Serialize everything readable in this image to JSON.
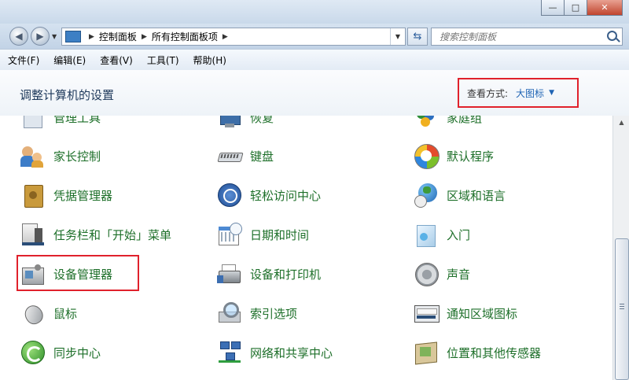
{
  "window": {
    "buttons": {
      "minimize": "—",
      "maximize": "□",
      "close": "✕"
    }
  },
  "address": {
    "breadcrumb": [
      "控制面板",
      "所有控制面板项"
    ],
    "search_placeholder": "搜索控制面板"
  },
  "menu": [
    "文件(F)",
    "编辑(E)",
    "查看(V)",
    "工具(T)",
    "帮助(H)"
  ],
  "header": {
    "title": "调整计算机的设置",
    "view_by_label": "查看方式:",
    "view_by_value": "大图标"
  },
  "items": {
    "row0": [
      "管理工具",
      "恢复",
      "家庭组"
    ],
    "row1": [
      "家长控制",
      "键盘",
      "默认程序"
    ],
    "row2": [
      "凭据管理器",
      "轻松访问中心",
      "区域和语言"
    ],
    "row3": [
      "任务栏和「开始」菜单",
      "日期和时间",
      "入门"
    ],
    "row4": [
      "设备管理器",
      "设备和打印机",
      "声音"
    ],
    "row5": [
      "鼠标",
      "索引选项",
      "通知区域图标"
    ],
    "row6": [
      "同步中心",
      "网络和共享中心",
      "位置和其他传感器"
    ]
  },
  "colors": {
    "item_label": "#1d6f29",
    "highlight": "#e0212c",
    "header_title": "#1e395b",
    "link_blue": "#1f64b4"
  }
}
